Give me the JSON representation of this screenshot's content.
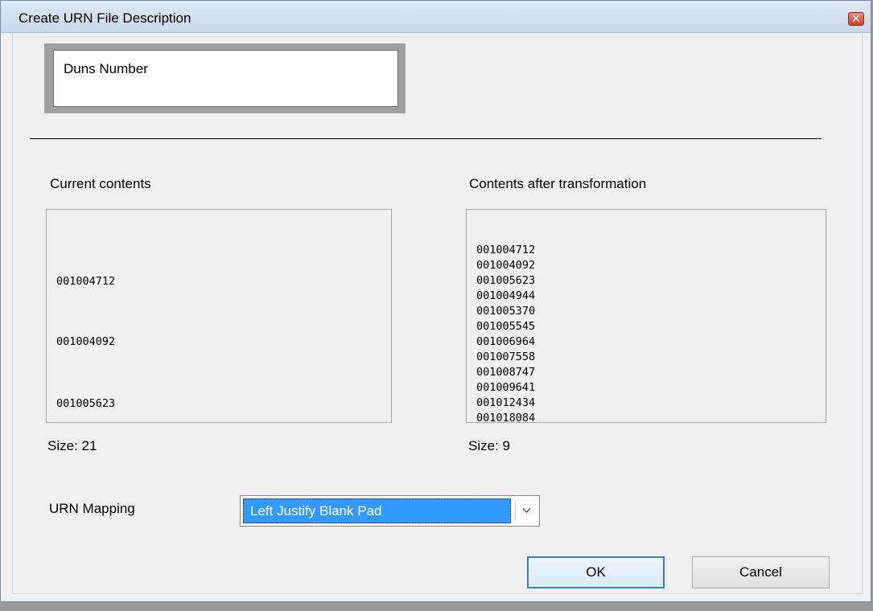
{
  "window": {
    "title": "Create URN File Description",
    "close_label": "✕"
  },
  "description": {
    "value": "Duns Number"
  },
  "current": {
    "label": "Current contents",
    "items": [
      "001004712",
      "001004092",
      "001005623"
    ],
    "size_label": "Size: 21"
  },
  "transformed": {
    "label": "Contents after transformation",
    "items": [
      "001004712",
      "001004092",
      "001005623",
      "001004944",
      "001005370",
      "001005545",
      "001006964",
      "001007558",
      "001008747",
      "001009641",
      "001012434",
      "001018084"
    ],
    "size_label": "Size: 9"
  },
  "mapping": {
    "label": "URN Mapping",
    "selected": "Left Justify Blank Pad"
  },
  "buttons": {
    "ok": "OK",
    "cancel": "Cancel"
  },
  "colors": {
    "selection": "#3399ff",
    "default_button_border": "#3c7fb1"
  }
}
